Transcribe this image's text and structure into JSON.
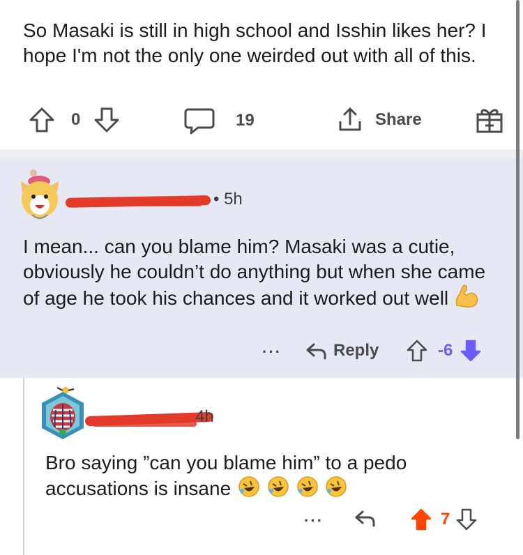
{
  "post": {
    "text": "So Masaki is still in high school and Isshin likes her? I hope I'm not the only one weirded out with all of this.",
    "vote_count": "0",
    "comment_count": "19",
    "share_label": "Share"
  },
  "comment1": {
    "time": "5h",
    "text": "I mean... can you blame him? Masaki was a cutie, obviously he couldn’t do anything but when she came of age he took his chances and it worked out well",
    "emoji": "flexed-biceps",
    "more_label": "···",
    "reply_label": "Reply",
    "vote_count": "-6"
  },
  "comment2": {
    "time": "4h",
    "text": "Bro saying ”can you blame him” to a pedo accusations is insane",
    "emoji": "rolling-on-floor-laughing",
    "more_label": "···",
    "vote_count": "7"
  },
  "colors": {
    "upvote": "#ff4500",
    "downvote": "#6a5cff",
    "highlight_bg": "#e6e8f4",
    "redaction": "#e23b2a"
  }
}
